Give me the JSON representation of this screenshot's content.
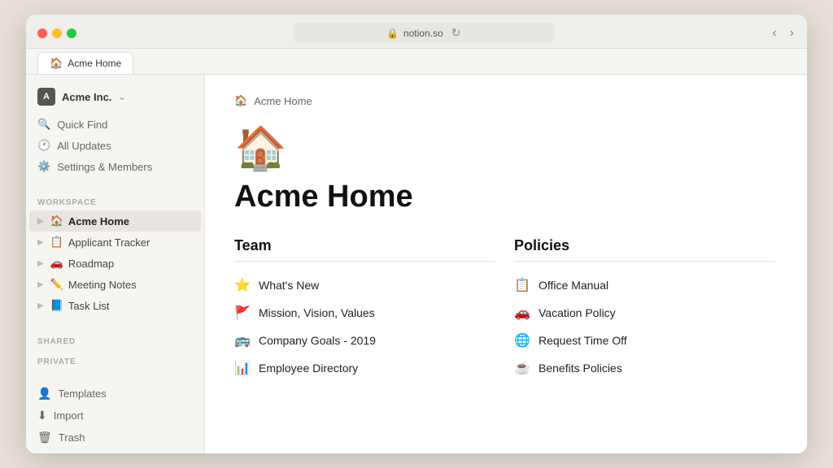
{
  "browser": {
    "traffic_lights": [
      "red",
      "yellow",
      "green"
    ],
    "address": "notion.so",
    "lock_icon": "🔒",
    "reload_icon": "↻",
    "back_icon": "‹",
    "forward_icon": "›",
    "tab_icon_notion": "N",
    "tab_label": "Acme Home"
  },
  "sidebar": {
    "workspace_name": "Acme Inc.",
    "workspace_icon": "A",
    "chevron_icon": "⌄",
    "actions": [
      {
        "id": "quick-find",
        "icon": "🔍",
        "label": "Quick Find"
      },
      {
        "id": "all-updates",
        "icon": "🕐",
        "label": "All Updates"
      },
      {
        "id": "settings",
        "icon": "⚙️",
        "label": "Settings & Members"
      }
    ],
    "workspace_section_label": "WORKSPACE",
    "workspace_items": [
      {
        "id": "acme-home",
        "emoji": "🏠",
        "label": "Acme Home",
        "active": true
      },
      {
        "id": "applicant-tracker",
        "emoji": "📋",
        "label": "Applicant Tracker",
        "active": false
      },
      {
        "id": "roadmap",
        "emoji": "🚗",
        "label": "Roadmap",
        "active": false
      },
      {
        "id": "meeting-notes",
        "emoji": "✏️",
        "label": "Meeting Notes",
        "active": false
      },
      {
        "id": "task-list",
        "emoji": "📘",
        "label": "Task List",
        "active": false
      }
    ],
    "shared_label": "SHARED",
    "private_label": "PRIVATE",
    "bottom_items": [
      {
        "id": "templates",
        "emoji": "👤",
        "label": "Templates"
      },
      {
        "id": "import",
        "emoji": "⬇",
        "label": "Import"
      },
      {
        "id": "trash",
        "emoji": "🗑",
        "label": "Trash"
      }
    ]
  },
  "main": {
    "breadcrumb_emoji": "🏠",
    "breadcrumb_title": "Acme Home",
    "page_emoji": "🏠",
    "page_title": "Acme Home",
    "team_section": {
      "heading": "Team",
      "links": [
        {
          "icon": "⭐",
          "label": "What's New"
        },
        {
          "icon": "🚩",
          "label": "Mission, Vision, Values"
        },
        {
          "icon": "🚌",
          "label": "Company Goals - 2019"
        },
        {
          "icon": "📊",
          "label": "Employee Directory"
        }
      ]
    },
    "policies_section": {
      "heading": "Policies",
      "links": [
        {
          "icon": "📋",
          "label": "Office Manual"
        },
        {
          "icon": "🚗",
          "label": "Vacation Policy"
        },
        {
          "icon": "🌐",
          "label": "Request Time Off"
        },
        {
          "icon": "☕",
          "label": "Benefits Policies"
        }
      ]
    }
  }
}
